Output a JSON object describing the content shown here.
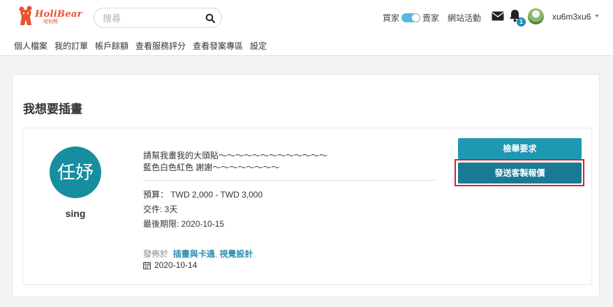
{
  "brand": {
    "logo_main": "HoliBear",
    "logo_sub": "哈利熊",
    "color": "#e8522c"
  },
  "search": {
    "placeholder": "搜尋",
    "value": ""
  },
  "header": {
    "buyer_label": "買家",
    "seller_label": "賣家",
    "site_events": "網站活動",
    "notification_count": "1",
    "username": "xu6m3xu6"
  },
  "nav": {
    "items": [
      "個人檔案",
      "我的訂單",
      "帳戶餘額",
      "查看服務評分",
      "查看發案專區",
      "設定"
    ]
  },
  "page": {
    "title": "我想要插畫"
  },
  "post": {
    "avatar_text": "任妤",
    "author": "sing",
    "description_line1": "請幫我畫我的大頭貼～～～～～～～～～～～～～",
    "description_line2": "藍色白色紅色 謝謝～～～～～～～～",
    "budget": "預算： TWD 2,000 - TWD 3,000",
    "delivery": "交件: 3天",
    "deadline": "最後期限: 2020-10-15",
    "posted_in_label": "發佈於",
    "category_1": "插畫與卡通",
    "category_2": "視覺設計",
    "post_date": "2020-10-14",
    "report_button": "檢舉要求",
    "quote_button": "發送客製報價"
  },
  "colors": {
    "accent": "#1e98b3",
    "accent_dark": "#1a7a96",
    "highlight": "#d9232f",
    "avatar_bg": "#178e9f"
  }
}
